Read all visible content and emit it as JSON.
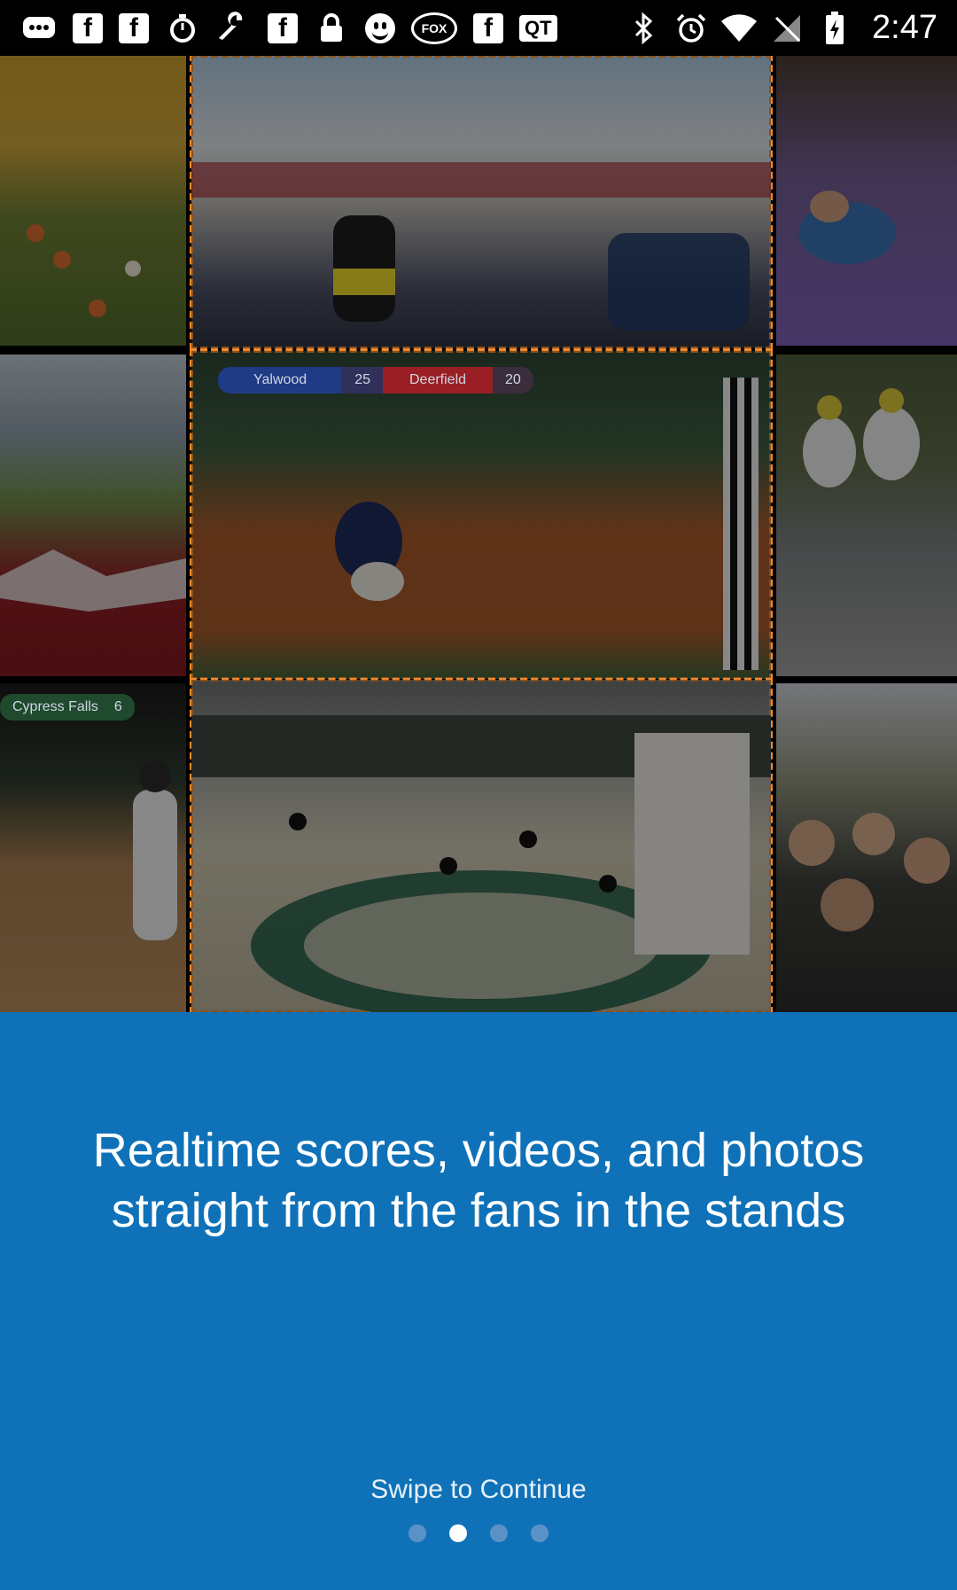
{
  "status_bar": {
    "time": "2:47",
    "left_icons": [
      "chat-bubble-icon",
      "facebook-icon",
      "facebook-icon",
      "stopwatch-icon",
      "wrench-icon",
      "facebook-icon",
      "lock-icon",
      "smiley-icon",
      "fox-sports-icon",
      "facebook-icon",
      "quicktime-icon"
    ],
    "fox_label": "FOX",
    "qt_label": "QT",
    "fb_label": "f",
    "right_icons": [
      "bluetooth-icon",
      "alarm-icon",
      "wifi-icon",
      "no-signal-icon",
      "battery-charging-icon"
    ]
  },
  "collage": {
    "score_overlay": {
      "team_home": "Yalwood",
      "score_home": "25",
      "team_away": "Deerfield",
      "score_away": "20"
    },
    "score_overlay_2": {
      "team": "Cypress Falls",
      "score": "6"
    }
  },
  "onboarding": {
    "headline_line1": "Realtime scores, videos, and photos",
    "headline_line2": "straight from the fans in the stands",
    "swipe_label": "Swipe to Continue",
    "page_count": 4,
    "active_page": 2
  },
  "colors": {
    "panel_blue": "#0f72b8",
    "accent_orange": "#f08a2e",
    "dot_inactive": "#5b92c6",
    "dot_active": "#ffffff"
  }
}
